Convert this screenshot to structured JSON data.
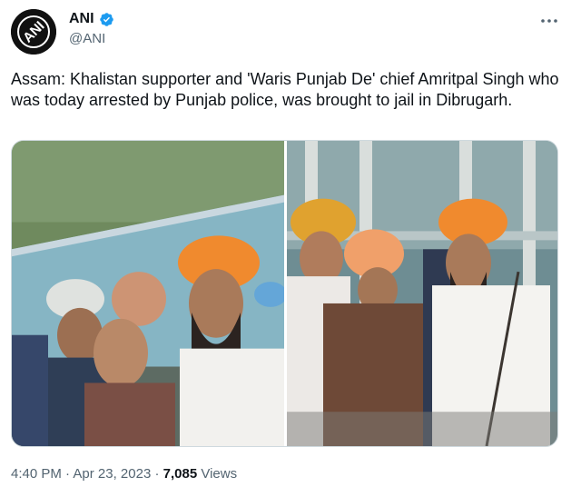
{
  "tweet": {
    "author_name": "ANI",
    "author_handle": "@ANI",
    "avatar_text": "ANI",
    "text": "Assam: Khalistan supporter and 'Waris Punjab De' chief Amritpal Singh who was today arrested by Punjab police, was brought to jail in Dibrugarh.",
    "time": "4:40 PM",
    "separator": "·",
    "date": "Apr 23, 2023",
    "views_count": "7,085",
    "views_label": "Views"
  },
  "icons": {
    "verified": "verified-badge-icon",
    "more": "more-dots-icon"
  },
  "colors": {
    "verified_blue": "#1d9bf0",
    "secondary_text": "#536471",
    "primary_text": "#0f1419",
    "turban_orange": "#f08a2e"
  }
}
